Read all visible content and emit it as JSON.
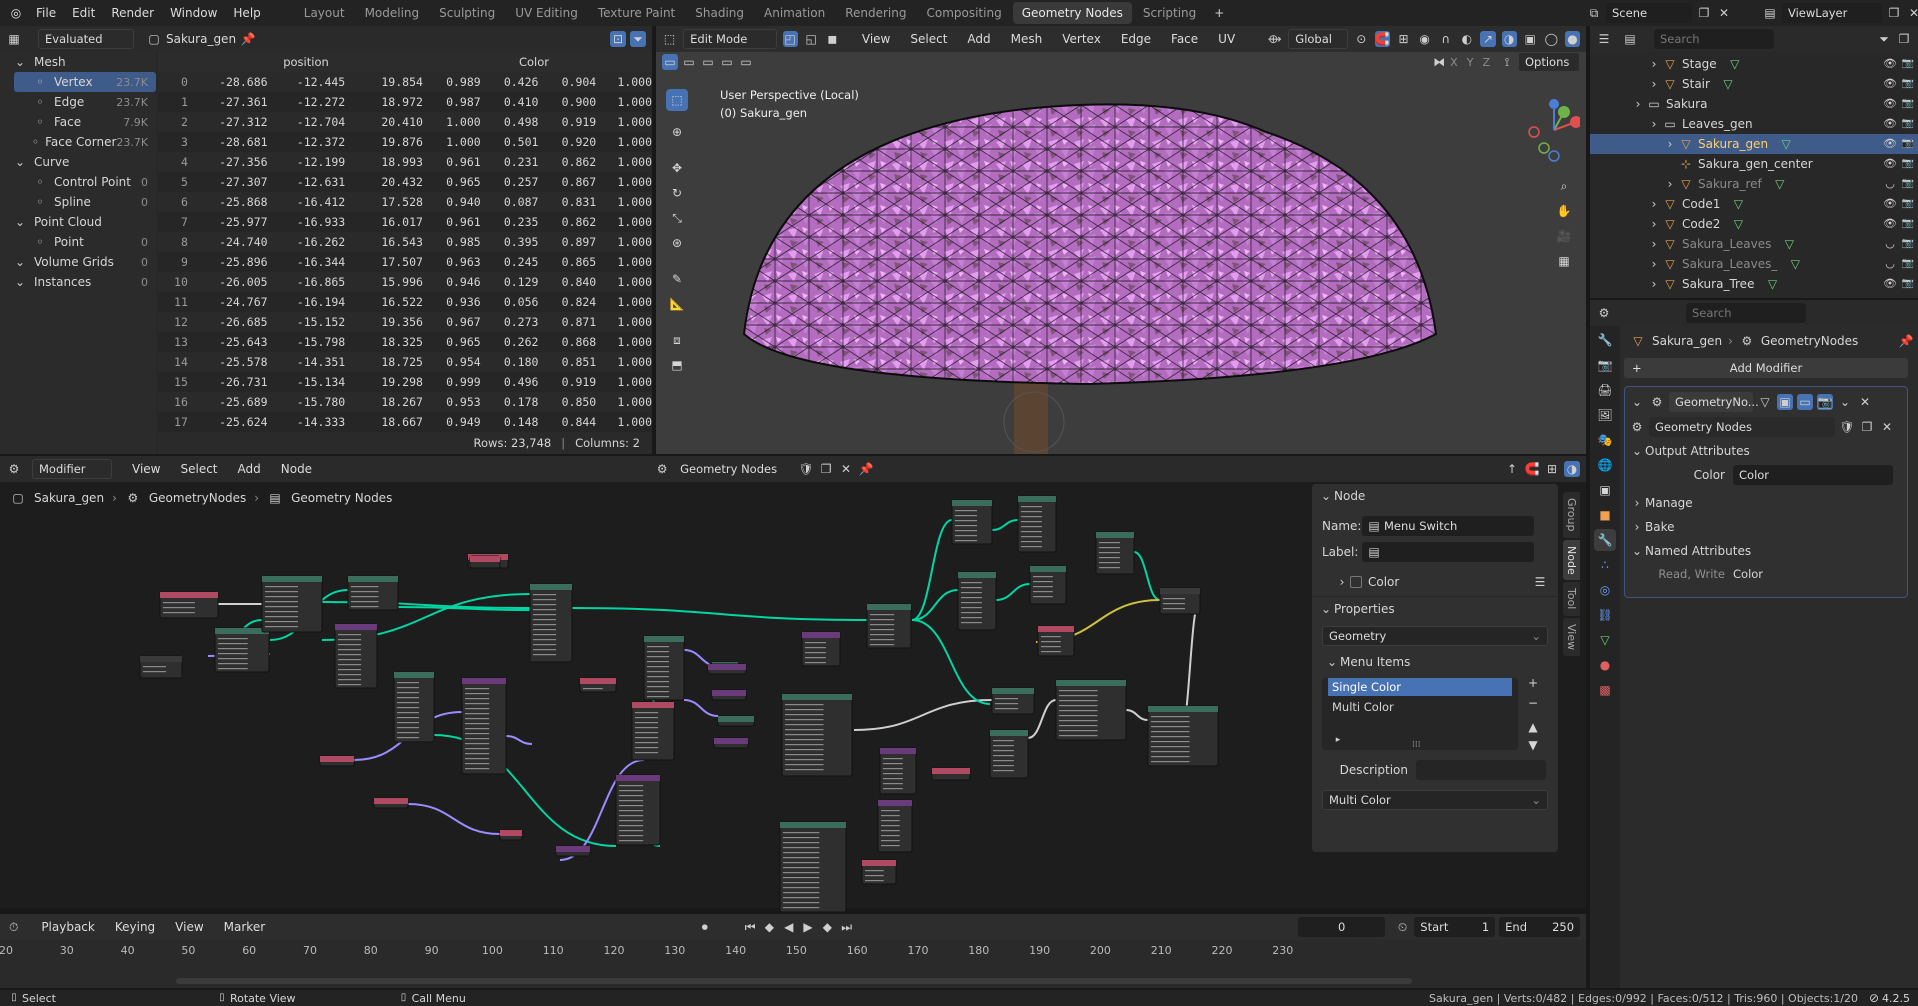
{
  "menus": [
    "File",
    "Edit",
    "Render",
    "Window",
    "Help"
  ],
  "workspaces": [
    "Layout",
    "Modeling",
    "Sculpting",
    "UV Editing",
    "Texture Paint",
    "Shading",
    "Animation",
    "Rendering",
    "Compositing",
    "Geometry Nodes",
    "Scripting"
  ],
  "active_workspace": "Geometry Nodes",
  "scene": "Scene",
  "view_layer": "ViewLayer",
  "spreadsheet": {
    "mode": "Evaluated",
    "object": "Sakura_gen",
    "tree": [
      {
        "label": "Mesh",
        "level": 0,
        "count": ""
      },
      {
        "label": "Vertex",
        "level": 1,
        "count": "23.7K",
        "selected": true
      },
      {
        "label": "Edge",
        "level": 1,
        "count": "23.7K"
      },
      {
        "label": "Face",
        "level": 1,
        "count": "7.9K"
      },
      {
        "label": "Face Corner",
        "level": 1,
        "count": "23.7K"
      },
      {
        "label": "Curve",
        "level": 0,
        "count": ""
      },
      {
        "label": "Control Point",
        "level": 1,
        "count": "0"
      },
      {
        "label": "Spline",
        "level": 1,
        "count": "0"
      },
      {
        "label": "Point Cloud",
        "level": 0,
        "count": ""
      },
      {
        "label": "Point",
        "level": 1,
        "count": "0"
      },
      {
        "label": "Volume Grids",
        "level": 0,
        "count": "0"
      },
      {
        "label": "Instances",
        "level": 0,
        "count": "0"
      }
    ],
    "columns": [
      "position",
      "Color"
    ],
    "rows": [
      [
        "0",
        "-28.686",
        "-12.445",
        "19.854",
        "0.989",
        "0.426",
        "0.904",
        "1.000"
      ],
      [
        "1",
        "-27.361",
        "-12.272",
        "18.972",
        "0.987",
        "0.410",
        "0.900",
        "1.000"
      ],
      [
        "2",
        "-27.312",
        "-12.704",
        "20.410",
        "1.000",
        "0.498",
        "0.919",
        "1.000"
      ],
      [
        "3",
        "-28.681",
        "-12.372",
        "19.876",
        "1.000",
        "0.501",
        "0.920",
        "1.000"
      ],
      [
        "4",
        "-27.356",
        "-12.199",
        "18.993",
        "0.961",
        "0.231",
        "0.862",
        "1.000"
      ],
      [
        "5",
        "-27.307",
        "-12.631",
        "20.432",
        "0.965",
        "0.257",
        "0.867",
        "1.000"
      ],
      [
        "6",
        "-25.868",
        "-16.412",
        "17.528",
        "0.940",
        "0.087",
        "0.831",
        "1.000"
      ],
      [
        "7",
        "-25.977",
        "-16.933",
        "16.017",
        "0.961",
        "0.235",
        "0.862",
        "1.000"
      ],
      [
        "8",
        "-24.740",
        "-16.262",
        "16.543",
        "0.985",
        "0.395",
        "0.897",
        "1.000"
      ],
      [
        "9",
        "-25.896",
        "-16.344",
        "17.507",
        "0.963",
        "0.245",
        "0.865",
        "1.000"
      ],
      [
        "10",
        "-26.005",
        "-16.865",
        "15.996",
        "0.946",
        "0.129",
        "0.840",
        "1.000"
      ],
      [
        "11",
        "-24.767",
        "-16.194",
        "16.522",
        "0.936",
        "0.056",
        "0.824",
        "1.000"
      ],
      [
        "12",
        "-26.685",
        "-15.152",
        "19.356",
        "0.967",
        "0.273",
        "0.871",
        "1.000"
      ],
      [
        "13",
        "-25.643",
        "-15.798",
        "18.325",
        "0.965",
        "0.262",
        "0.868",
        "1.000"
      ],
      [
        "14",
        "-25.578",
        "-14.351",
        "18.725",
        "0.954",
        "0.180",
        "0.851",
        "1.000"
      ],
      [
        "15",
        "-26.731",
        "-15.134",
        "19.298",
        "0.999",
        "0.496",
        "0.919",
        "1.000"
      ],
      [
        "16",
        "-25.689",
        "-15.780",
        "18.267",
        "0.953",
        "0.178",
        "0.850",
        "1.000"
      ],
      [
        "17",
        "-25.624",
        "-14.333",
        "18.667",
        "0.949",
        "0.148",
        "0.844",
        "1.000"
      ]
    ],
    "rows_label": "Rows: 23,748",
    "columns_label": "Columns: 2"
  },
  "viewport": {
    "mode": "Edit Mode",
    "menus": [
      "View",
      "Select",
      "Add",
      "Mesh",
      "Vertex",
      "Edge",
      "Face",
      "UV"
    ],
    "transform": "Global",
    "overlay_line1": "User Perspective (Local)",
    "overlay_line2": "(0) Sakura_gen",
    "options": "Options",
    "axes": [
      "X",
      "Y",
      "Z"
    ]
  },
  "outliner": {
    "search_placeholder": "Search",
    "items": [
      {
        "label": "Stage",
        "indent": 3,
        "type": "mesh"
      },
      {
        "label": "Stair",
        "indent": 3,
        "type": "mesh"
      },
      {
        "label": "Sakura",
        "indent": 2,
        "type": "collection"
      },
      {
        "label": "Leaves_gen",
        "indent": 3,
        "type": "collection"
      },
      {
        "label": "Sakura_gen",
        "indent": 4,
        "type": "mesh",
        "selected": true
      },
      {
        "label": "Sakura_gen_center",
        "indent": 4,
        "type": "empty"
      },
      {
        "label": "Sakura_ref",
        "indent": 4,
        "type": "mesh",
        "dim": true
      },
      {
        "label": "Code1",
        "indent": 3,
        "type": "mesh"
      },
      {
        "label": "Code2",
        "indent": 3,
        "type": "mesh"
      },
      {
        "label": "Sakura_Leaves",
        "indent": 3,
        "type": "mesh",
        "dim": true
      },
      {
        "label": "Sakura_Leaves_",
        "indent": 3,
        "type": "mesh",
        "dim": true
      },
      {
        "label": "Sakura_Tree",
        "indent": 3,
        "type": "mesh"
      }
    ]
  },
  "properties": {
    "search_placeholder": "Search",
    "breadcrumb_object": "Sakura_gen",
    "breadcrumb_modifier": "GeometryNodes",
    "add_modifier": "Add Modifier",
    "modifier_name": "GeometryNo...",
    "node_group": "Geometry Nodes",
    "output_attributes": "Output Attributes",
    "color_label": "Color",
    "color_value": "Color",
    "manage": "Manage",
    "bake": "Bake",
    "named_attributes": "Named Attributes",
    "rw_label": "Read, Write",
    "rw_value": "Color"
  },
  "node_editor": {
    "mode": "Modifier",
    "menus": [
      "View",
      "Select",
      "Add",
      "Node"
    ],
    "tree_name": "Geometry Nodes",
    "breadcrumb": [
      "Sakura_gen",
      "GeometryNodes",
      "Geometry Nodes"
    ],
    "sidebar_tabs": [
      "Group",
      "Node",
      "Tool",
      "View"
    ],
    "node_panel": {
      "title": "Node",
      "name_label": "Name:",
      "name_value": "Menu Switch",
      "label_label": "Label:",
      "label_value": "",
      "color": "Color",
      "properties": "Properties",
      "type": "Geometry",
      "menu_items": "Menu Items",
      "items": [
        "Single Color",
        "Multi Color"
      ],
      "description_label": "Description",
      "default": "Multi Color"
    }
  },
  "timeline": {
    "menus": [
      "Playback",
      "Keying",
      "View",
      "Marker"
    ],
    "current_frame": "0",
    "start_label": "Start",
    "start": "1",
    "end_label": "End",
    "end": "250",
    "ticks": [
      "20",
      "30",
      "40",
      "50",
      "60",
      "70",
      "80",
      "90",
      "100",
      "110",
      "120",
      "130",
      "140",
      "150",
      "160",
      "170",
      "180",
      "190",
      "200",
      "210",
      "220",
      "230"
    ]
  },
  "statusbar": {
    "select": "Select",
    "rotate": "Rotate View",
    "call_menu": "Call Menu",
    "stats": "Sakura_gen | Verts:0/482 | Edges:0/992 | Faces:0/512 | Tris:960 | Objects:1/20",
    "version": "4.2.5"
  },
  "colors": {
    "accent": "#4772b3",
    "selection": "#3f5b8a",
    "geometry_wire": "#00d6a3",
    "field_wire": "#9a8cff",
    "mesh_icon": "#e8a050",
    "collection_icon": "#d0d0d0"
  }
}
